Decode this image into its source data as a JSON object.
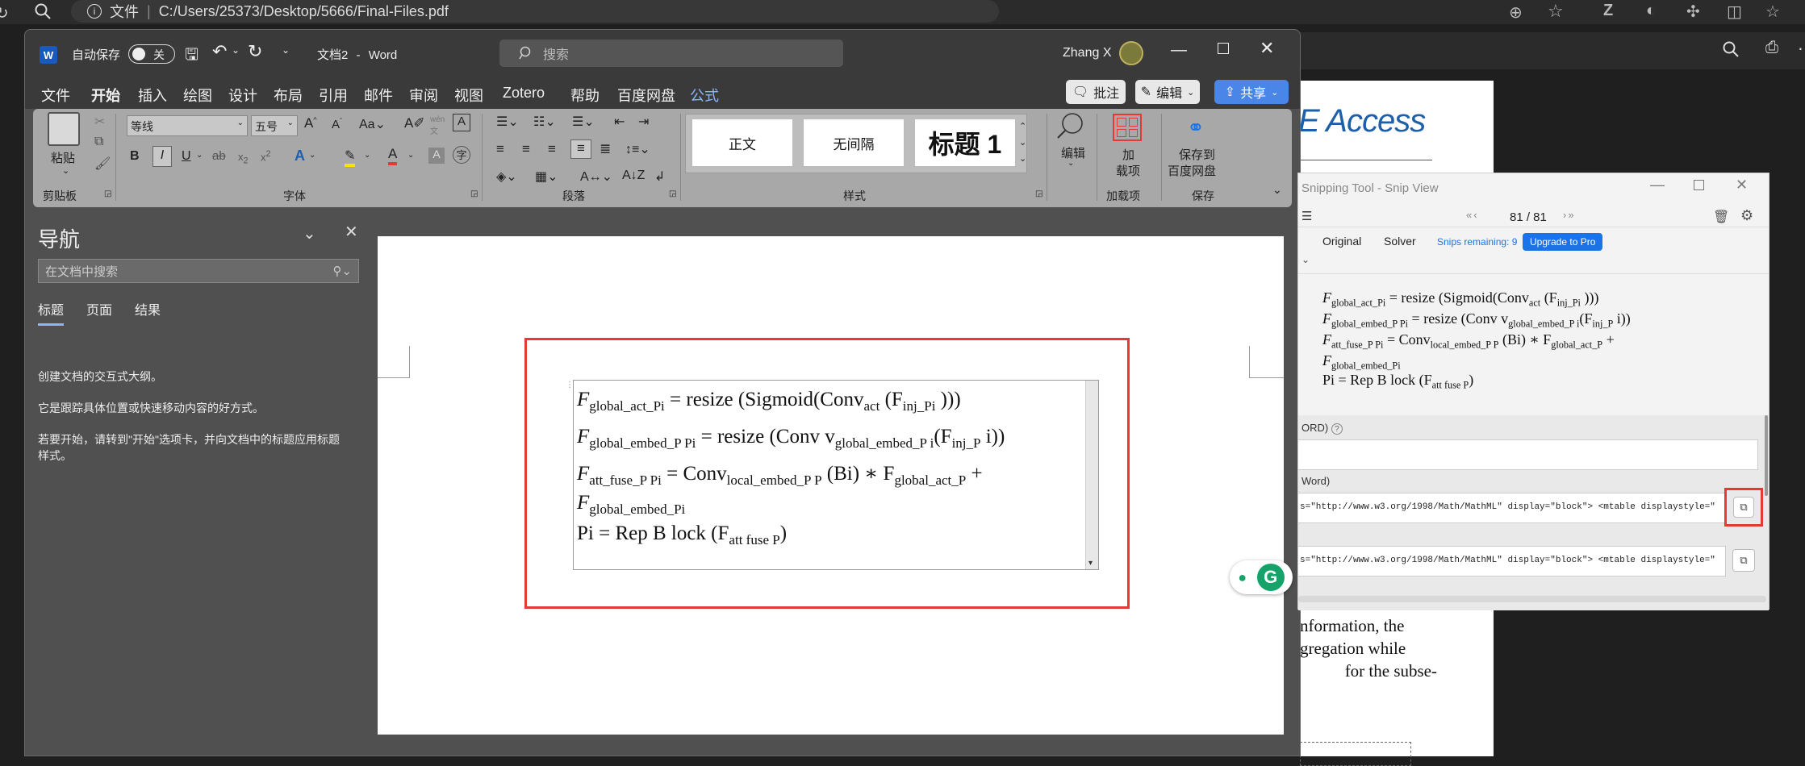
{
  "browser": {
    "file_label": "文件",
    "path": "C:/Users/25373/Desktop/5666/Final-Files.pdf"
  },
  "word": {
    "autosave_label": "自动保存",
    "autosave_state": "关",
    "doc_title": "文档2",
    "app_name": "Word",
    "title_sep": "-",
    "search_placeholder": "搜索",
    "user_name": "Zhang X",
    "menu": [
      "文件",
      "开始",
      "插入",
      "绘图",
      "设计",
      "布局",
      "引用",
      "邮件",
      "审阅",
      "视图",
      "Zotero",
      "帮助",
      "百度网盘",
      "公式"
    ],
    "comment_btn": "批注",
    "edit_btn": "编辑",
    "share_btn": "共享",
    "ribbon": {
      "paste": "粘贴",
      "clipboard": "剪贴板",
      "font_name": "等线",
      "font_size": "五号",
      "font_group": "字体",
      "paragraph_group": "段落",
      "styles_group": "样式",
      "style_normal": "正文",
      "style_nospacing": "无间隔",
      "style_heading1": "标题 1",
      "edit": "编辑",
      "addin1": "加",
      "addin2": "载项",
      "addin_group": "加载项",
      "save_baidu1": "保存到",
      "save_baidu2": "百度网盘",
      "save_group": "保存"
    },
    "nav": {
      "title": "导航",
      "search_placeholder": "在文档中搜索",
      "tabs": [
        "标题",
        "页面",
        "结果"
      ],
      "p1": "创建文档的交互式大纲。",
      "p2": "它是跟踪具体位置或快速移动内容的好方式。",
      "p3a": "若要开始，请转到\"开始\"选项卡，并向文档中的标题应用标题",
      "p3b": "样式。"
    },
    "equations": {
      "l1a": "F",
      "l1sub": "global_act_Pi",
      "l1b": " = resize (Sigmoid(Conv",
      "l1sub2": "act",
      "l1c": " (F",
      "l1sub3": "inj_Pi",
      "l1d": " )))",
      "l2a": "F",
      "l2sub": "global_embed_P Pi",
      "l2b": " = resize (Conv v",
      "l2sub2": "global_embed_P i",
      "l2c": "(F",
      "l2sub3": "inj_P",
      "l2d": " i))",
      "l3a": "F",
      "l3sub": "att_fuse_P Pi",
      "l3b": " = Conv",
      "l3sub2": "local_embed_P P",
      "l3c": " (Bi) ∗ F",
      "l3sub3": "global_act_P",
      "l3d": " +",
      "l4a": "F",
      "l4sub": "global_embed_Pi",
      "l5a": "Pi = Rep B lock (F",
      "l5sub": "att  fuse P",
      "l5b": ")"
    }
  },
  "pdf": {
    "access": "E Access",
    "t1": "nformation, the",
    "t2": "gregation while",
    "t3": "for the subse-"
  },
  "snip": {
    "title": "Snipping Tool - Snip View",
    "page": "81 / 81",
    "tab_original": "Original",
    "tab_solver": "Solver",
    "remaining": "Snips remaining: 9",
    "upgrade": "Upgrade to Pro",
    "label1": "ORD)",
    "label2": "Word)",
    "code1": "s=\"http://www.w3.org/1998/Math/MathML\" display=\"block\">   <mtable displaystyle=\"",
    "code2": "s=\"http://www.w3.org/1998/Math/MathML\" display=\"block\">   <mtable displaystyle=\""
  },
  "colors": {
    "highlight_red": "#e53935",
    "accent_blue": "#1a73e8",
    "grammarly_green": "#15a36a"
  }
}
